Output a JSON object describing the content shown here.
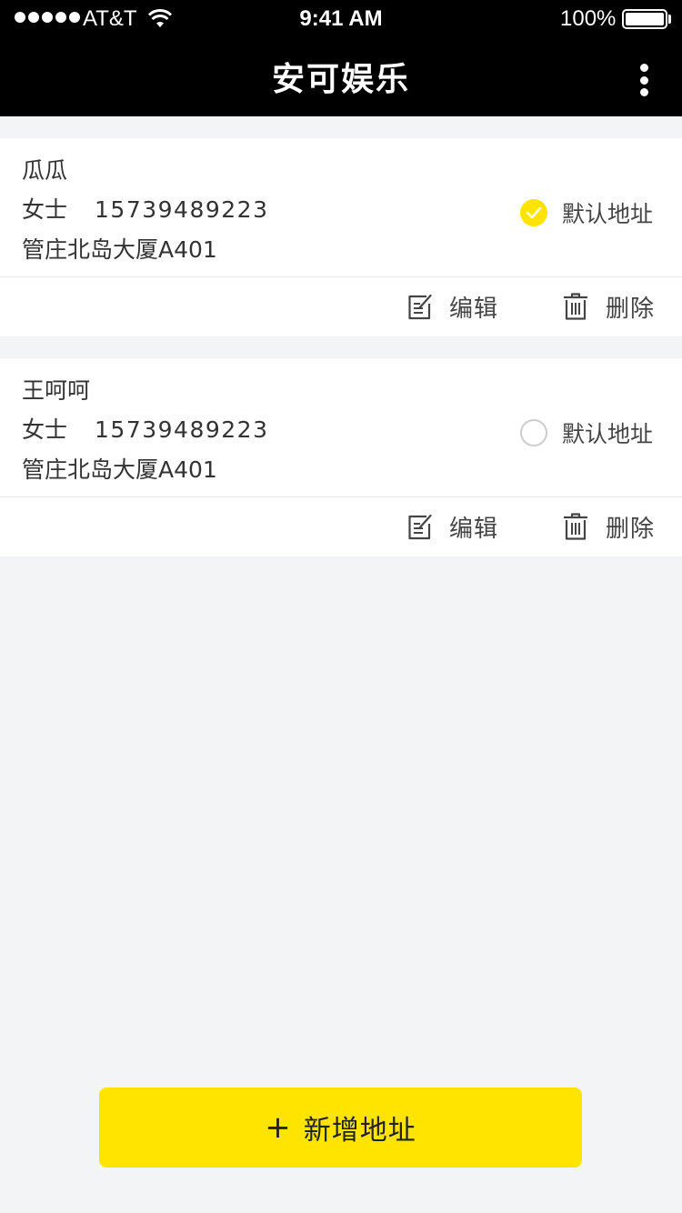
{
  "status_bar": {
    "carrier": "AT&T",
    "time": "9:41 AM",
    "battery": "100%",
    "battery_level": 1.0
  },
  "nav": {
    "title": "安可娱乐",
    "more_icon": "more-vertical-icon"
  },
  "addresses": [
    {
      "name": "瓜瓜",
      "title": "女士",
      "phone": "15739489223",
      "address": "管庄北岛大厦A401",
      "is_default": true,
      "default_label": "默认地址",
      "edit_label": "编辑",
      "delete_label": "删除"
    },
    {
      "name": "王呵呵",
      "title": "女士",
      "phone": "15739489223",
      "address": "管庄北岛大厦A401",
      "is_default": false,
      "default_label": "默认地址",
      "edit_label": "编辑",
      "delete_label": "删除"
    }
  ],
  "add_button": {
    "icon": "+",
    "label": "新增地址"
  },
  "colors": {
    "accent": "#ffe400",
    "header_bg": "#000000",
    "page_bg": "#f3f4f6"
  }
}
